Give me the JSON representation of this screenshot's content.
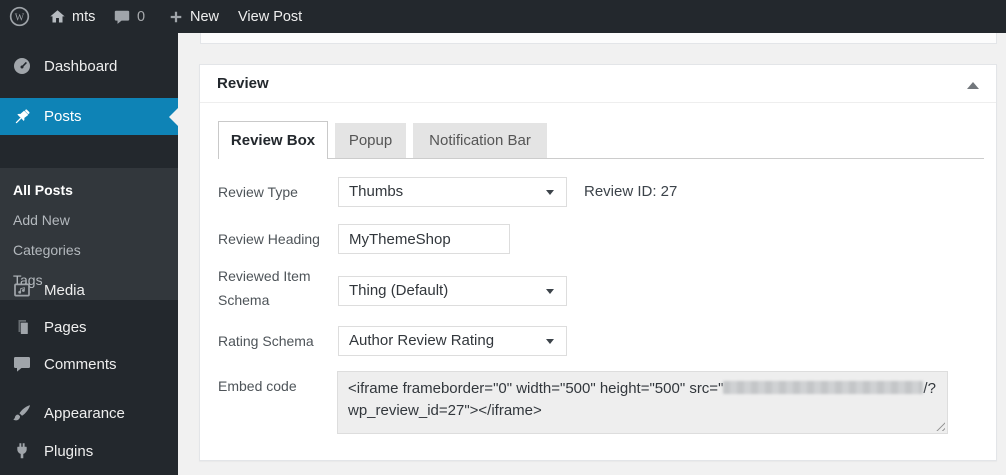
{
  "admin_bar": {
    "site_name": "mts",
    "comment_count": "0",
    "new_label": "New",
    "view_post_label": "View Post"
  },
  "sidebar": {
    "items": [
      {
        "label": "Dashboard",
        "icon": "dashboard-icon"
      },
      {
        "label": "Posts",
        "icon": "pushpin-icon",
        "active": true
      },
      {
        "label": "Media",
        "icon": "media-icon"
      },
      {
        "label": "Pages",
        "icon": "pages-icon"
      },
      {
        "label": "Comments",
        "icon": "comments-icon"
      },
      {
        "label": "Appearance",
        "icon": "appearance-icon"
      },
      {
        "label": "Plugins",
        "icon": "plugins-icon"
      }
    ],
    "posts_submenu": [
      {
        "label": "All Posts",
        "active": true
      },
      {
        "label": "Add New"
      },
      {
        "label": "Categories"
      },
      {
        "label": "Tags"
      }
    ]
  },
  "metabox": {
    "title": "Review",
    "tabs": {
      "review_box": "Review Box",
      "popup": "Popup",
      "notification_bar": "Notification Bar"
    },
    "review_type": {
      "label": "Review Type",
      "value": "Thumbs"
    },
    "review_id_text": "Review ID: 27",
    "review_heading": {
      "label": "Review Heading",
      "value": "MyThemeShop"
    },
    "reviewed_item_schema": {
      "label": "Reviewed Item Schema",
      "value": "Thing (Default)"
    },
    "rating_schema": {
      "label": "Rating Schema",
      "value": "Author Review Rating"
    },
    "embed_code": {
      "label": "Embed code",
      "line1_before_blur": "<iframe frameborder=\"0\" width=\"500\" height=\"500\" src=\"",
      "line1_after_blur": "/?",
      "line2": "wp_review_id=27\"></iframe>"
    }
  },
  "colors": {
    "accent_blue": "#0e83b6",
    "admin_dark": "#23282d",
    "submenu_dark": "#32373c",
    "content_bg": "#f1f1f1"
  }
}
